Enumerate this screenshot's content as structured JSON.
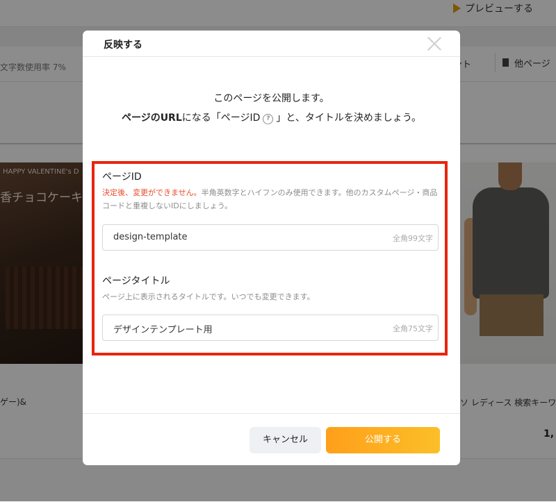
{
  "background": {
    "preview_label": "プレビューする",
    "char_usage": "文字数使用率 7%",
    "toolbar_item_1": "ント",
    "toolbar_item_2": "他ページ",
    "banner_small": "HAPPY VALENTINE's D",
    "banner_large": "香チョコケーキ",
    "product_label_left": "ゲー)&",
    "product_label_right": "ソ レディース 検索キーワ",
    "product_price_right": "1,"
  },
  "modal": {
    "title": "反映する",
    "intro_line1": "このページを公開します。",
    "intro_line2_bold": "ページのURL",
    "intro_line2_mid": "になる「ページID",
    "intro_help": "?",
    "intro_line2_end": "」と、タイトルを決めましょう。",
    "page_id": {
      "label": "ページID",
      "warning": "決定後、変更ができません。",
      "note": "半角英数字とハイフンのみ使用できます。他のカスタムページ・商品コードと重複しないIDにしましょう。",
      "value": "design-template",
      "limit": "全角99文字"
    },
    "page_title": {
      "label": "ページタイトル",
      "note": "ページ上に表示されるタイトルです。いつでも変更できます。",
      "value": "デザインテンプレート用",
      "limit": "全角75文字"
    },
    "cancel_label": "キャンセル",
    "publish_label": "公開する"
  },
  "colors": {
    "accent": "#fbb420",
    "highlight": "#e8250e",
    "warning_text": "#e84b2a"
  }
}
